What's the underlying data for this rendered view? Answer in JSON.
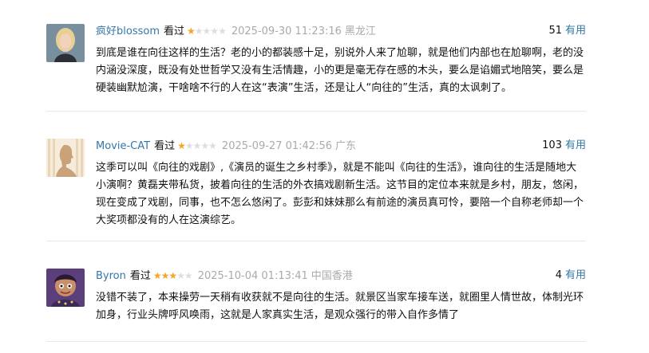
{
  "reviews": [
    {
      "user": "疯好blossom",
      "watched_label": "看过",
      "rating": 1,
      "rating_max": 5,
      "time": "2025-09-30 11:23:16",
      "location": "黑龙江",
      "useful_count": "51",
      "useful_label": "有用",
      "text": "到底是谁在向往这样的生活？老的小的都装感十足，别说外人来了尬聊，就是他们内部也在尬聊啊，老的没内涵没深度，既没有处世哲学又没有生活情趣，小的更是毫无存在感的木头，要么是谄媚式地陪笑，要么是硬装幽默尬演，干啥啥不行的人在这“表演”生活，还是让人“向往的”生活，真的太讽刺了。",
      "avatar": "photo-woman-blonde"
    },
    {
      "user": "Movie-CAT",
      "watched_label": "看过",
      "rating": 1,
      "rating_max": 5,
      "time": "2025-09-27 01:42:56",
      "location": "广东",
      "useful_count": "103",
      "useful_label": "有用",
      "text": "这季可以叫《向往的戏剧》,《演员的诞生之乡村季》，就是不能叫《向往的生活》，谁向往的生活是随地大小演啊？黄磊夹带私货，披着向往的生活的外衣搞戏剧新生活。这节目的定位本来就是乡村，朋友，悠闲，现在变成了戏剧，同事，也不怎么悠闲了。彭彭和妹妹那么有前途的演员真可怜，要陪一个自称老师却一个大奖项都没有的人在这演综艺。",
      "avatar": "silhouette-profile"
    },
    {
      "user": "Byron",
      "watched_label": "看过",
      "rating": 3,
      "rating_max": 5,
      "time": "2025-10-04 01:13:41",
      "location": "中国香港",
      "useful_count": "4",
      "useful_label": "有用",
      "text": "没错不装了，本来操劳一天稍有收获就不是向往的生活。就景区当家车接车送，就圈里人情世故，体制光环加身，行业头牌呼风唤雨，这就是人家真实生活，是观众强行的带入自作多情了",
      "avatar": "cartoon-character"
    }
  ],
  "colors": {
    "link": "#3377aa",
    "star_on": "#f5a623",
    "star_off": "#dddddd",
    "meta": "#aaaaaa",
    "divider": "#e8e8e8"
  }
}
